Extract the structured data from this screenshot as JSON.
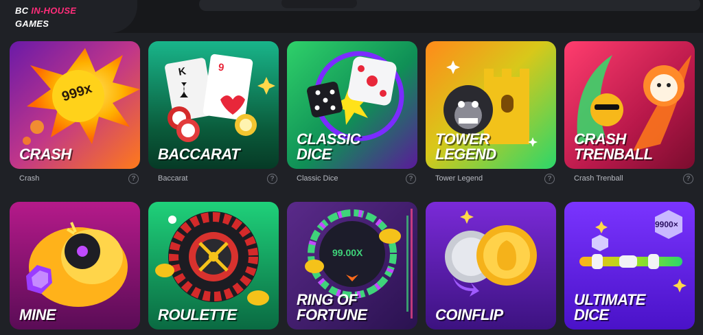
{
  "section": {
    "title_prefix": "BC",
    "title_accent": "IN-HOUSE",
    "title_line2": "GAMES"
  },
  "games": [
    {
      "key": "crash",
      "tile_title": "CRASH",
      "caption": "Crash",
      "badge": "999x",
      "help": "?"
    },
    {
      "key": "baccarat",
      "tile_title": "BACCARAT",
      "caption": "Baccarat",
      "card_ranks": [
        "K",
        "9"
      ],
      "help": "?"
    },
    {
      "key": "classic-dice",
      "tile_title": "CLASSIC\nDICE",
      "caption": "Classic Dice",
      "help": "?"
    },
    {
      "key": "tower-legend",
      "tile_title": "TOWER\nLEGEND",
      "caption": "Tower Legend",
      "help": "?"
    },
    {
      "key": "crash-trenball",
      "tile_title": "CRASH\nTRENBALL",
      "caption": "Crash Trenball",
      "help": "?"
    },
    {
      "key": "mine",
      "tile_title": "MINE"
    },
    {
      "key": "roulette",
      "tile_title": "ROULETTE"
    },
    {
      "key": "ring-of-fortune",
      "tile_title": "RING OF\nFORTUNE",
      "badge": "99.00X"
    },
    {
      "key": "coinflip",
      "tile_title": "COINFLIP"
    },
    {
      "key": "ultimate-dice",
      "tile_title": "ULTIMATE\nDICE",
      "badge": "9900×"
    }
  ]
}
